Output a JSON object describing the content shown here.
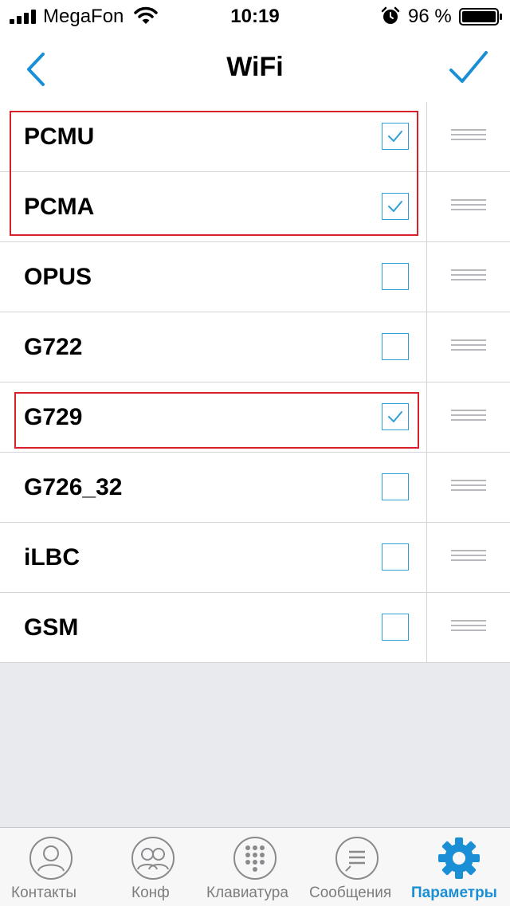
{
  "status_bar": {
    "carrier": "MegaFon",
    "time": "10:19",
    "battery": "96 %"
  },
  "nav": {
    "title": "WiFi",
    "back_icon": "chevron-left-icon",
    "done_icon": "checkmark-icon"
  },
  "codecs": [
    {
      "name": "PCMU",
      "checked": true
    },
    {
      "name": "PCMA",
      "checked": true
    },
    {
      "name": "OPUS",
      "checked": false
    },
    {
      "name": "G722",
      "checked": false
    },
    {
      "name": "G729",
      "checked": true
    },
    {
      "name": "G726_32",
      "checked": false
    },
    {
      "name": "iLBC",
      "checked": false
    },
    {
      "name": "GSM",
      "checked": false
    }
  ],
  "tabs": [
    {
      "label": "Контакты",
      "icon": "contacts-icon",
      "active": false
    },
    {
      "label": "Конф",
      "icon": "conference-icon",
      "active": false
    },
    {
      "label": "Клавиатура",
      "icon": "keypad-icon",
      "active": false
    },
    {
      "label": "Сообщения",
      "icon": "messages-icon",
      "active": false
    },
    {
      "label": "Параметры",
      "icon": "settings-gear-icon",
      "active": true
    }
  ],
  "colors": {
    "accent": "#1a8fd6",
    "checkbox_border": "#2d9fd9",
    "highlight": "#d8202a",
    "background": "#e8eaed"
  }
}
